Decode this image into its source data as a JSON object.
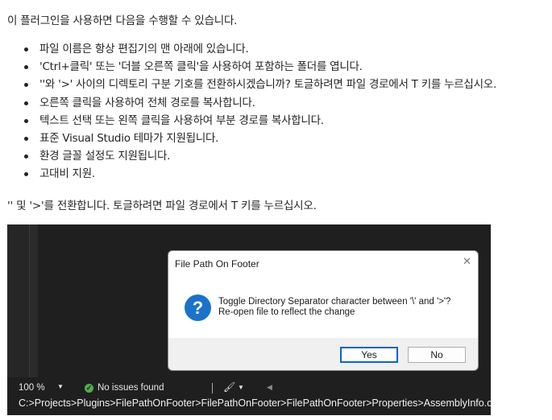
{
  "intro": "이 플러그인을 사용하면 다음을 수행할 수 있습니다.",
  "features": [
    "파일 이름은 항상 편집기의 맨 아래에 있습니다.",
    "'Ctrl+클릭' 또는 '더블 오른쪽 클릭'을 사용하여 포함하는 폴더를 엽니다.",
    "''와 '>' 사이의 디렉토리 구분 기호를 전환하시겠습니까? 토글하려면 파일 경로에서 T 키를 누르십시오.",
    "오른쪽 클릭을 사용하여 전체 경로를 복사합니다.",
    "텍스트 선택 또는 왼쪽 클릭을 사용하여 부분 경로를 복사합니다.",
    "표준 Visual Studio 테마가 지원됩니다.",
    "환경 글꼴 설정도 지원됩니다.",
    "고대비 지원."
  ],
  "toggle_note": "'' 및 '>'를 전환합니다. 토글하려면 파일 경로에서 T 키를 누르십시오.",
  "screenshot": {
    "status": {
      "zoom": "100 %",
      "issues": "No issues found"
    },
    "path": "C:>Projects>Plugins>FilePathOnFooter>FilePathOnFooter>FilePathOnFooter>Properties>AssemblyInfo.cs",
    "dialog": {
      "title": "File Path On Footer",
      "message_line1": "Toggle Directory Separator character between '\\' and '>'?",
      "message_line2": "Re-open file to reflect the change",
      "yes_label": "Yes",
      "no_label": "No"
    }
  },
  "icons": {
    "dialog_icon": "question-icon",
    "status_ok": "check-circle-icon",
    "cleanup": "brush-icon"
  },
  "colors": {
    "editor_bg": "#1f1f1f",
    "question_icon_bg": "#1a73c8",
    "ok_green": "#4caf50",
    "default_button_border": "#0a64c8"
  }
}
